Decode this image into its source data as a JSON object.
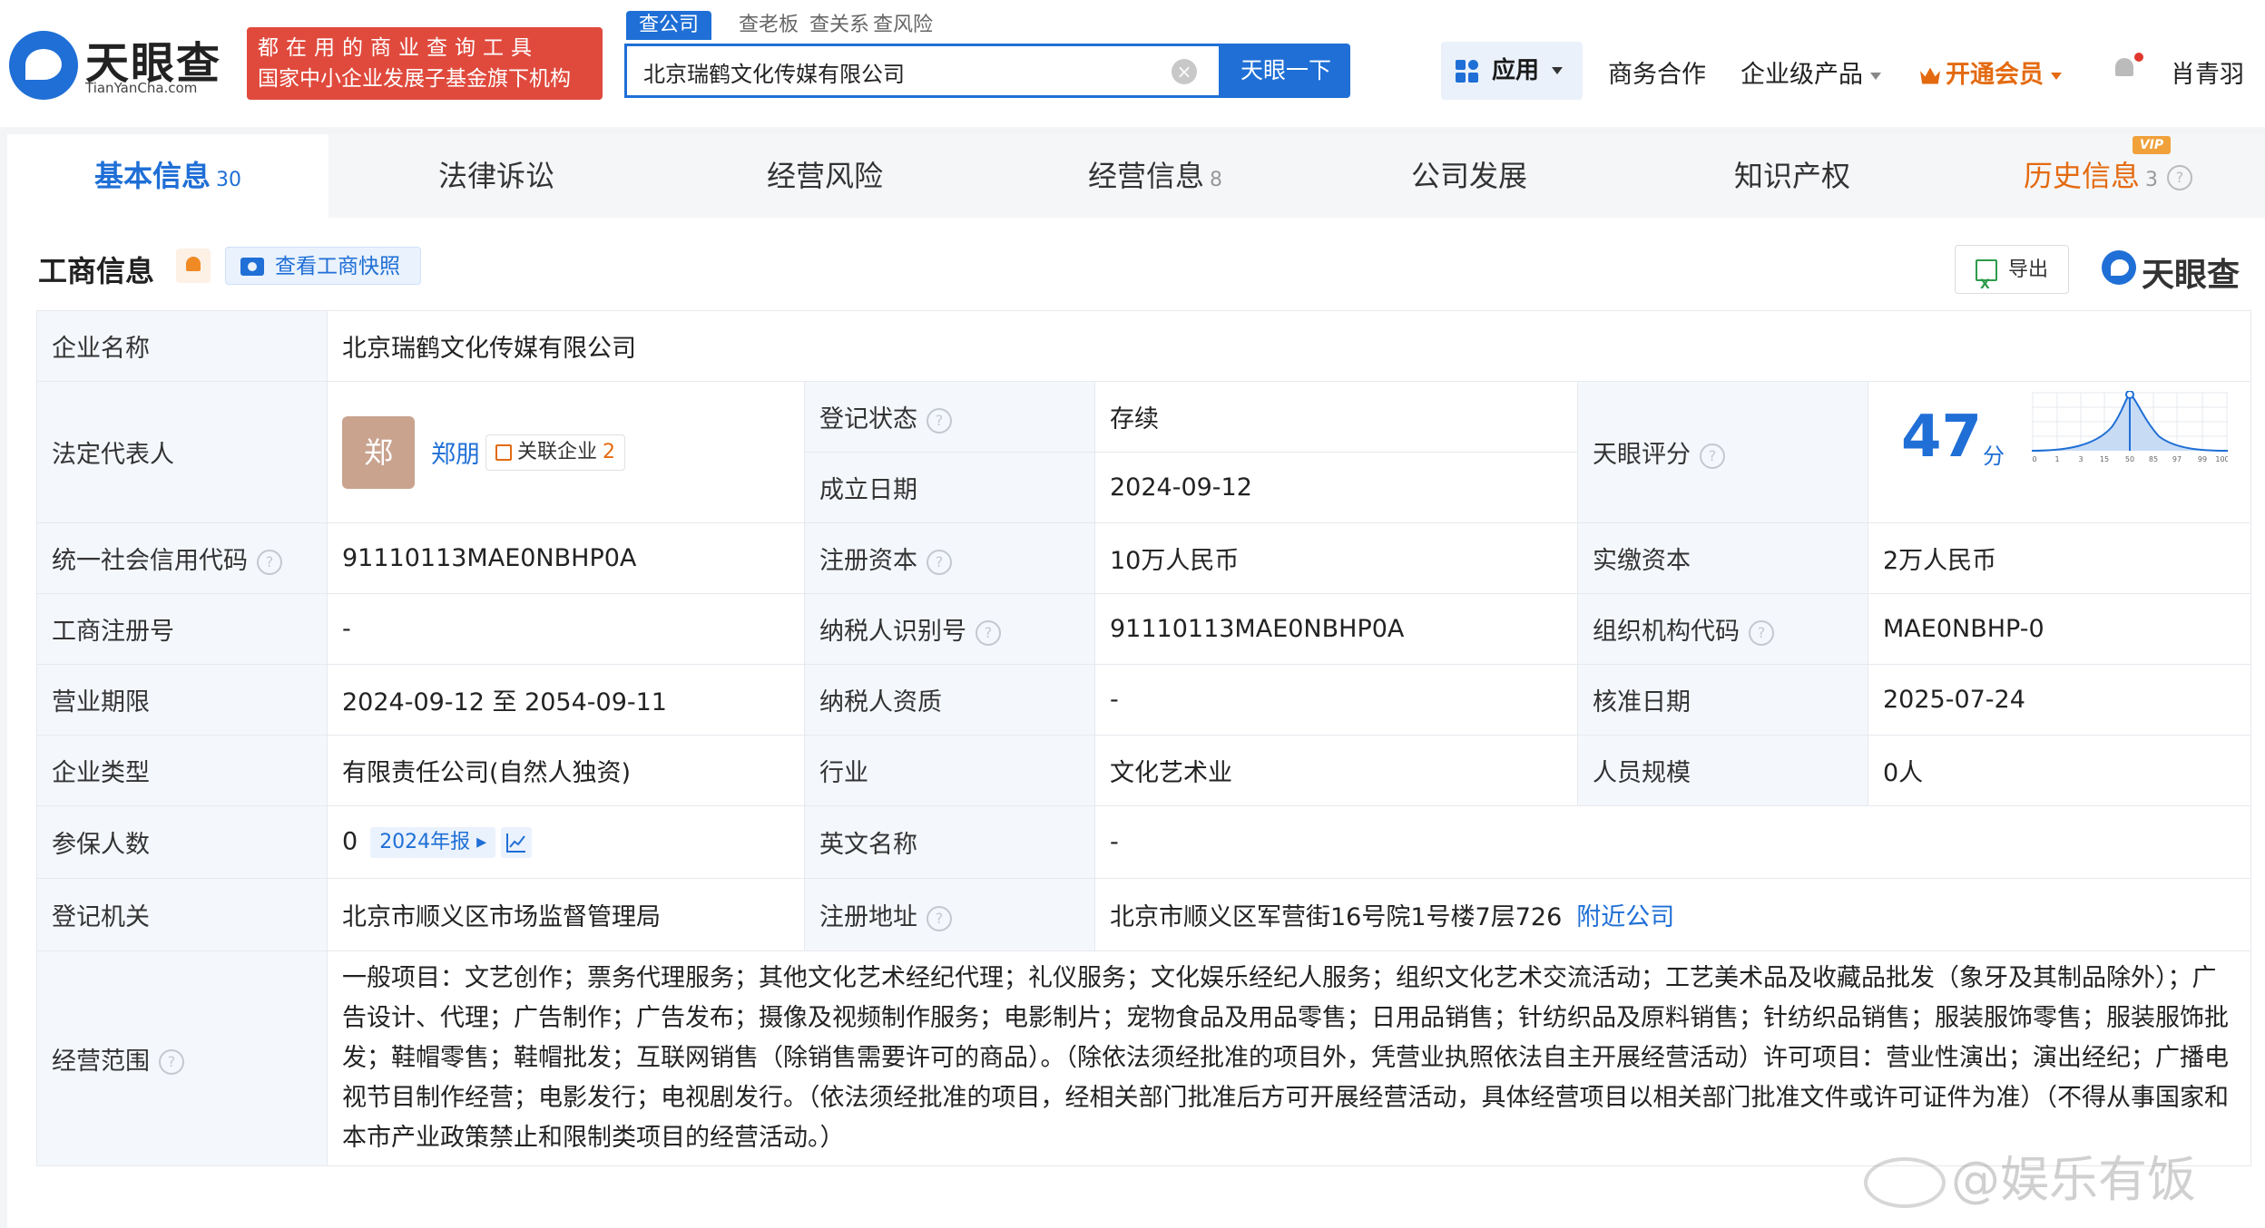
{
  "header": {
    "logo_text": "天眼查",
    "logo_sub": "TianYanCha.com",
    "slogan_line1": "都在用的商业查询工具",
    "slogan_line2": "国家中小企业发展子基金旗下机构",
    "search_tabs": [
      "查公司",
      "查老板",
      "查关系",
      "查风险"
    ],
    "search_value": "北京瑞鹤文化传媒有限公司",
    "search_button": "天眼一下",
    "nav": {
      "apps": "应用",
      "business": "商务合作",
      "enterprise": "企业级产品",
      "vip": "开通会员",
      "user": "肖青羽"
    }
  },
  "tabs": [
    {
      "label": "基本信息",
      "count": "30"
    },
    {
      "label": "法律诉讼",
      "count": ""
    },
    {
      "label": "经营风险",
      "count": ""
    },
    {
      "label": "经营信息",
      "count": "8"
    },
    {
      "label": "公司发展",
      "count": ""
    },
    {
      "label": "知识产权",
      "count": ""
    },
    {
      "label": "历史信息",
      "count": "3"
    }
  ],
  "vip_badge": "VIP",
  "section": {
    "title": "工商信息",
    "snapshot_button": "查看工商快照",
    "export_button": "导出",
    "brand": "天眼查"
  },
  "info": {
    "company_name_label": "企业名称",
    "company_name": "北京瑞鹤文化传媒有限公司",
    "legal_rep_label": "法定代表人",
    "legal_rep_avatar": "郑",
    "legal_rep_name": "郑朋",
    "related_label": "关联企业",
    "related_count": "2",
    "status_label": "登记状态",
    "status": "存续",
    "founded_label": "成立日期",
    "founded": "2024-09-12",
    "score_label": "天眼评分",
    "score": "47",
    "score_unit": "分",
    "score_ticks": [
      "0",
      "1",
      "3",
      "15",
      "50",
      "85",
      "97",
      "99",
      "100"
    ],
    "credit_code_label": "统一社会信用代码",
    "credit_code": "91110113MAE0NBHP0A",
    "reg_capital_label": "注册资本",
    "reg_capital": "10万人民币",
    "paid_capital_label": "实缴资本",
    "paid_capital": "2万人民币",
    "reg_no_label": "工商注册号",
    "reg_no": "-",
    "taxpayer_id_label": "纳税人识别号",
    "taxpayer_id": "91110113MAE0NBHP0A",
    "org_code_label": "组织机构代码",
    "org_code": "MAE0NBHP-0",
    "term_label": "营业期限",
    "term": "2024-09-12 至 2054-09-11",
    "tax_qual_label": "纳税人资质",
    "tax_qual": "-",
    "approve_date_label": "核准日期",
    "approve_date": "2025-07-24",
    "type_label": "企业类型",
    "type": "有限责任公司(自然人独资)",
    "industry_label": "行业",
    "industry": "文化艺术业",
    "staff_label": "人员规模",
    "staff": "0人",
    "insured_label": "参保人数",
    "insured": "0",
    "annual_report": "2024年报",
    "english_name_label": "英文名称",
    "english_name": "-",
    "authority_label": "登记机关",
    "authority": "北京市顺义区市场监督管理局",
    "address_label": "注册地址",
    "address": "北京市顺义区军营街16号院1号楼7层726",
    "nearby_link": "附近公司",
    "scope_label": "经营范围",
    "scope": "一般项目：文艺创作；票务代理服务；其他文化艺术经纪代理；礼仪服务；文化娱乐经纪人服务；组织文化艺术交流活动；工艺美术品及收藏品批发（象牙及其制品除外）；广告设计、代理；广告制作；广告发布；摄像及视频制作服务；电影制片；宠物食品及用品零售；日用品销售；针纺织品及原料销售；针纺织品销售；服装服饰零售；服装服饰批发；鞋帽零售；鞋帽批发；互联网销售（除销售需要许可的商品）。（除依法须经批准的项目外，凭营业执照依法自主开展经营活动）许可项目：营业性演出；演出经纪；广播电视节目制作经营；电影发行；电视剧发行。（依法须经批准的项目，经相关部门批准后方可开展经营活动，具体经营项目以相关部门批准文件或许可证件为准）（不得从事国家和本市产业政策禁止和限制类项目的经营活动。）"
  },
  "watermark": "@娱乐有饭",
  "colors": {
    "accent": "#1f6fd6",
    "vip": "#e46a10",
    "status_green": "#31a35b",
    "slogan_bg": "#e04a3d"
  }
}
